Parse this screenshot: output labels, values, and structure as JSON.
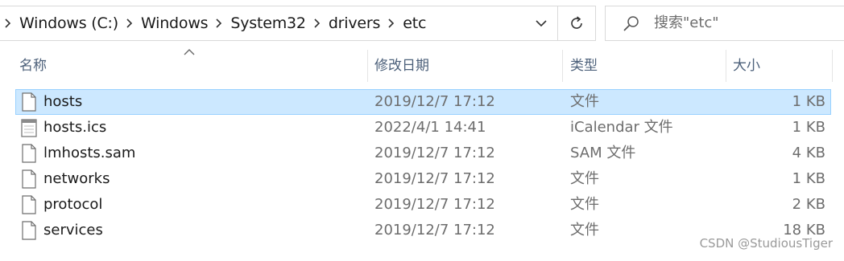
{
  "address_bar": {
    "breadcrumbs": [
      "Windows (C:)",
      "Windows",
      "System32",
      "drivers",
      "etc"
    ]
  },
  "search": {
    "placeholder": "搜索\"etc\""
  },
  "columns": {
    "name": "名称",
    "date": "修改日期",
    "type": "类型",
    "size": "大小"
  },
  "files": [
    {
      "name": "hosts",
      "modified": "2019/12/7 17:12",
      "type": "文件",
      "size": "1 KB",
      "icon": "file-icon",
      "selected": true
    },
    {
      "name": "hosts.ics",
      "modified": "2022/4/1 14:41",
      "type": "iCalendar 文件",
      "size": "1 KB",
      "icon": "calendar-file-icon",
      "selected": false
    },
    {
      "name": "lmhosts.sam",
      "modified": "2019/12/7 17:12",
      "type": "SAM 文件",
      "size": "4 KB",
      "icon": "file-icon",
      "selected": false
    },
    {
      "name": "networks",
      "modified": "2019/12/7 17:12",
      "type": "文件",
      "size": "1 KB",
      "icon": "file-icon",
      "selected": false
    },
    {
      "name": "protocol",
      "modified": "2019/12/7 17:12",
      "type": "文件",
      "size": "2 KB",
      "icon": "file-icon",
      "selected": false
    },
    {
      "name": "services",
      "modified": "2019/12/7 17:12",
      "type": "文件",
      "size": "18 KB",
      "icon": "file-icon",
      "selected": false
    }
  ],
  "watermark": "CSDN @StudiousTiger",
  "colors": {
    "selection_bg": "#cce8ff",
    "selection_border": "#99d1ff",
    "header_text": "#4c607a"
  }
}
